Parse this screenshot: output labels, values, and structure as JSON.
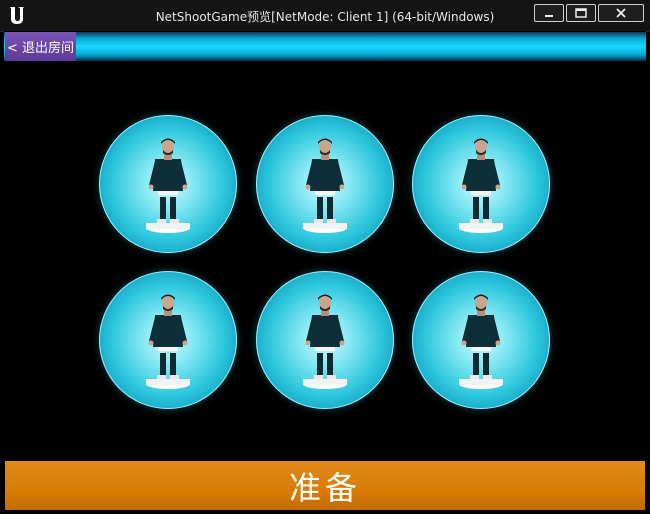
{
  "window": {
    "title": "NetShootGame预览[NetMode: Client 1]  (64-bit/Windows)",
    "controls": {
      "minimize": "–",
      "maximize": "□",
      "close": "✕"
    }
  },
  "game": {
    "exit_label": "< 退出房间",
    "ready_label": "准备",
    "colors": {
      "accent": "#16d9ff",
      "exit_bg": "#6b45a8",
      "ready_bg": "#d87c05"
    },
    "slots": [
      {
        "icon": "character-icon"
      },
      {
        "icon": "character-icon"
      },
      {
        "icon": "character-icon"
      },
      {
        "icon": "character-icon"
      },
      {
        "icon": "character-icon"
      },
      {
        "icon": "character-icon"
      }
    ]
  }
}
